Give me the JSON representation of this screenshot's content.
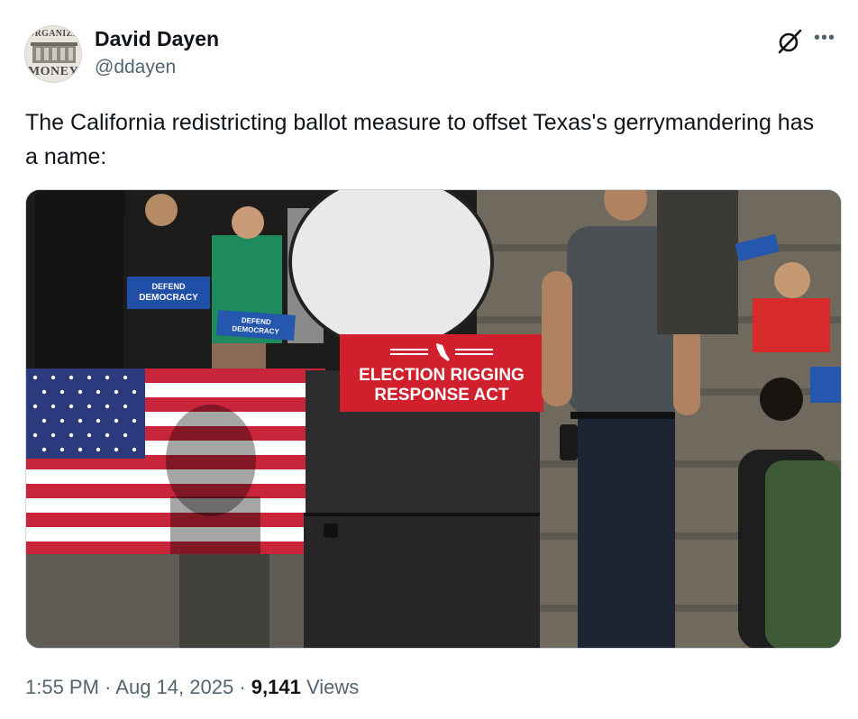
{
  "author": {
    "name": "David Dayen",
    "handle": "@ddayen",
    "avatar_text_top": "ORGANIZE",
    "avatar_text_bottom": "MONEY"
  },
  "tweet": {
    "text": "The California redistricting ballot measure to offset Texas's gerrymandering has a name:"
  },
  "media": {
    "sign_line1": "ELECTION RIGGING",
    "sign_line2": "RESPONSE ACT",
    "placard_line1": "DEFEND",
    "placard_line2": "DEMOCRACY"
  },
  "footer": {
    "time": "1:55 PM",
    "sep1": "·",
    "date": "Aug 14, 2025",
    "sep2": "·",
    "views_count": "9,141",
    "views_label": "Views"
  },
  "icons": {
    "grok": "grok-icon",
    "more": "more-icon"
  },
  "colors": {
    "text": "#0f1419",
    "secondary": "#536471",
    "sign_red": "#d0202e",
    "placard_blue": "#1f4fa6"
  }
}
